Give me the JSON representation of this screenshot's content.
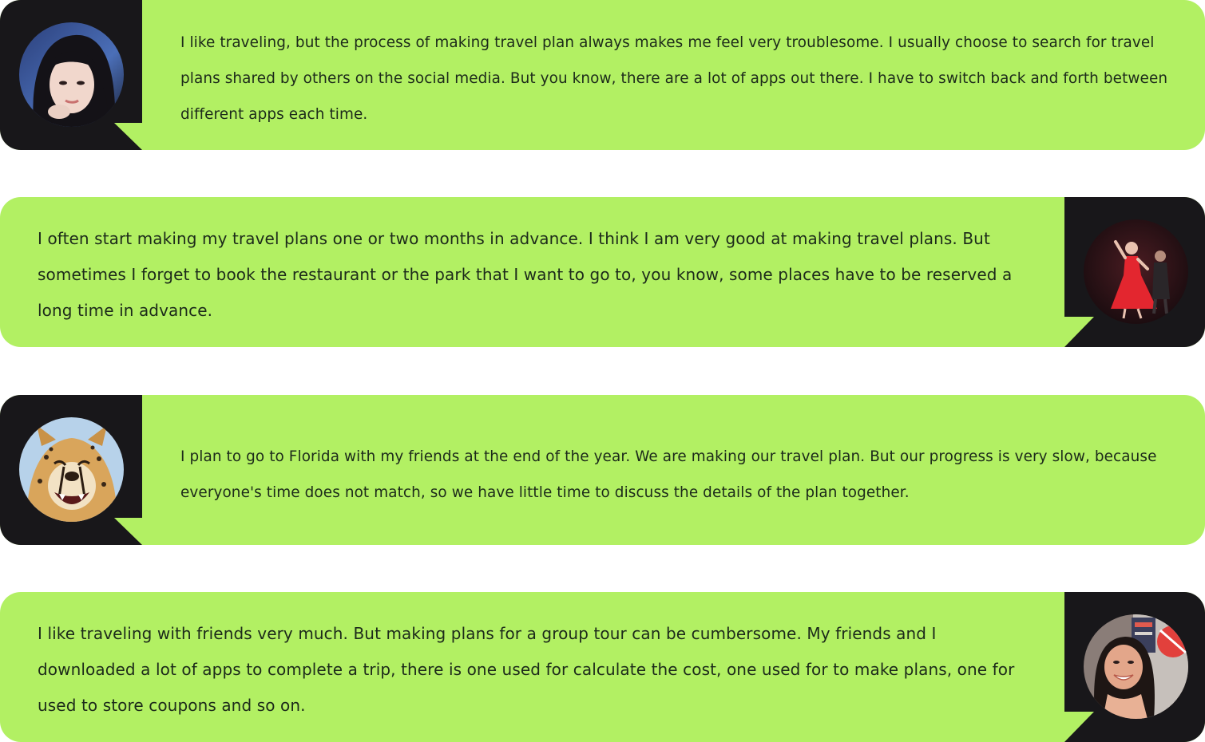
{
  "theme": {
    "card_color": "#b2f063",
    "panel_color": "#18171a",
    "text_color": "#1c2a1a"
  },
  "quotes": [
    {
      "avatar_side": "left",
      "avatar_icon": "avatar-woman-dark-hair-icon",
      "text": "I like traveling, but the process of making travel plan always makes me feel very troublesome. I usually choose to search for travel plans shared by others on the social media. But you know, there are a lot of apps out there. I have to switch back and forth between different apps each time."
    },
    {
      "avatar_side": "right",
      "avatar_icon": "avatar-dancers-red-dress-icon",
      "text": "I often start making my travel plans one or two months in advance. I think I am very good at making travel plans. But sometimes I forget to book the restaurant or the park that I want to go to, you know, some places have to be reserved a long time in advance."
    },
    {
      "avatar_side": "left",
      "avatar_icon": "avatar-cheetah-icon",
      "text": "I plan to go to Florida with my friends at the end of the year. We are making our travel plan. But our progress is very slow, because everyone's time does not match, so we have little time to discuss the details of the plan together."
    },
    {
      "avatar_side": "right",
      "avatar_icon": "avatar-smiling-woman-icon",
      "text": "I like traveling with friends very much. But making plans for a group tour can be cumbersome. My friends and I downloaded a lot of apps to complete a trip, there is one used for calculate the cost, one used for to make plans, one for used to store coupons and so on."
    }
  ]
}
